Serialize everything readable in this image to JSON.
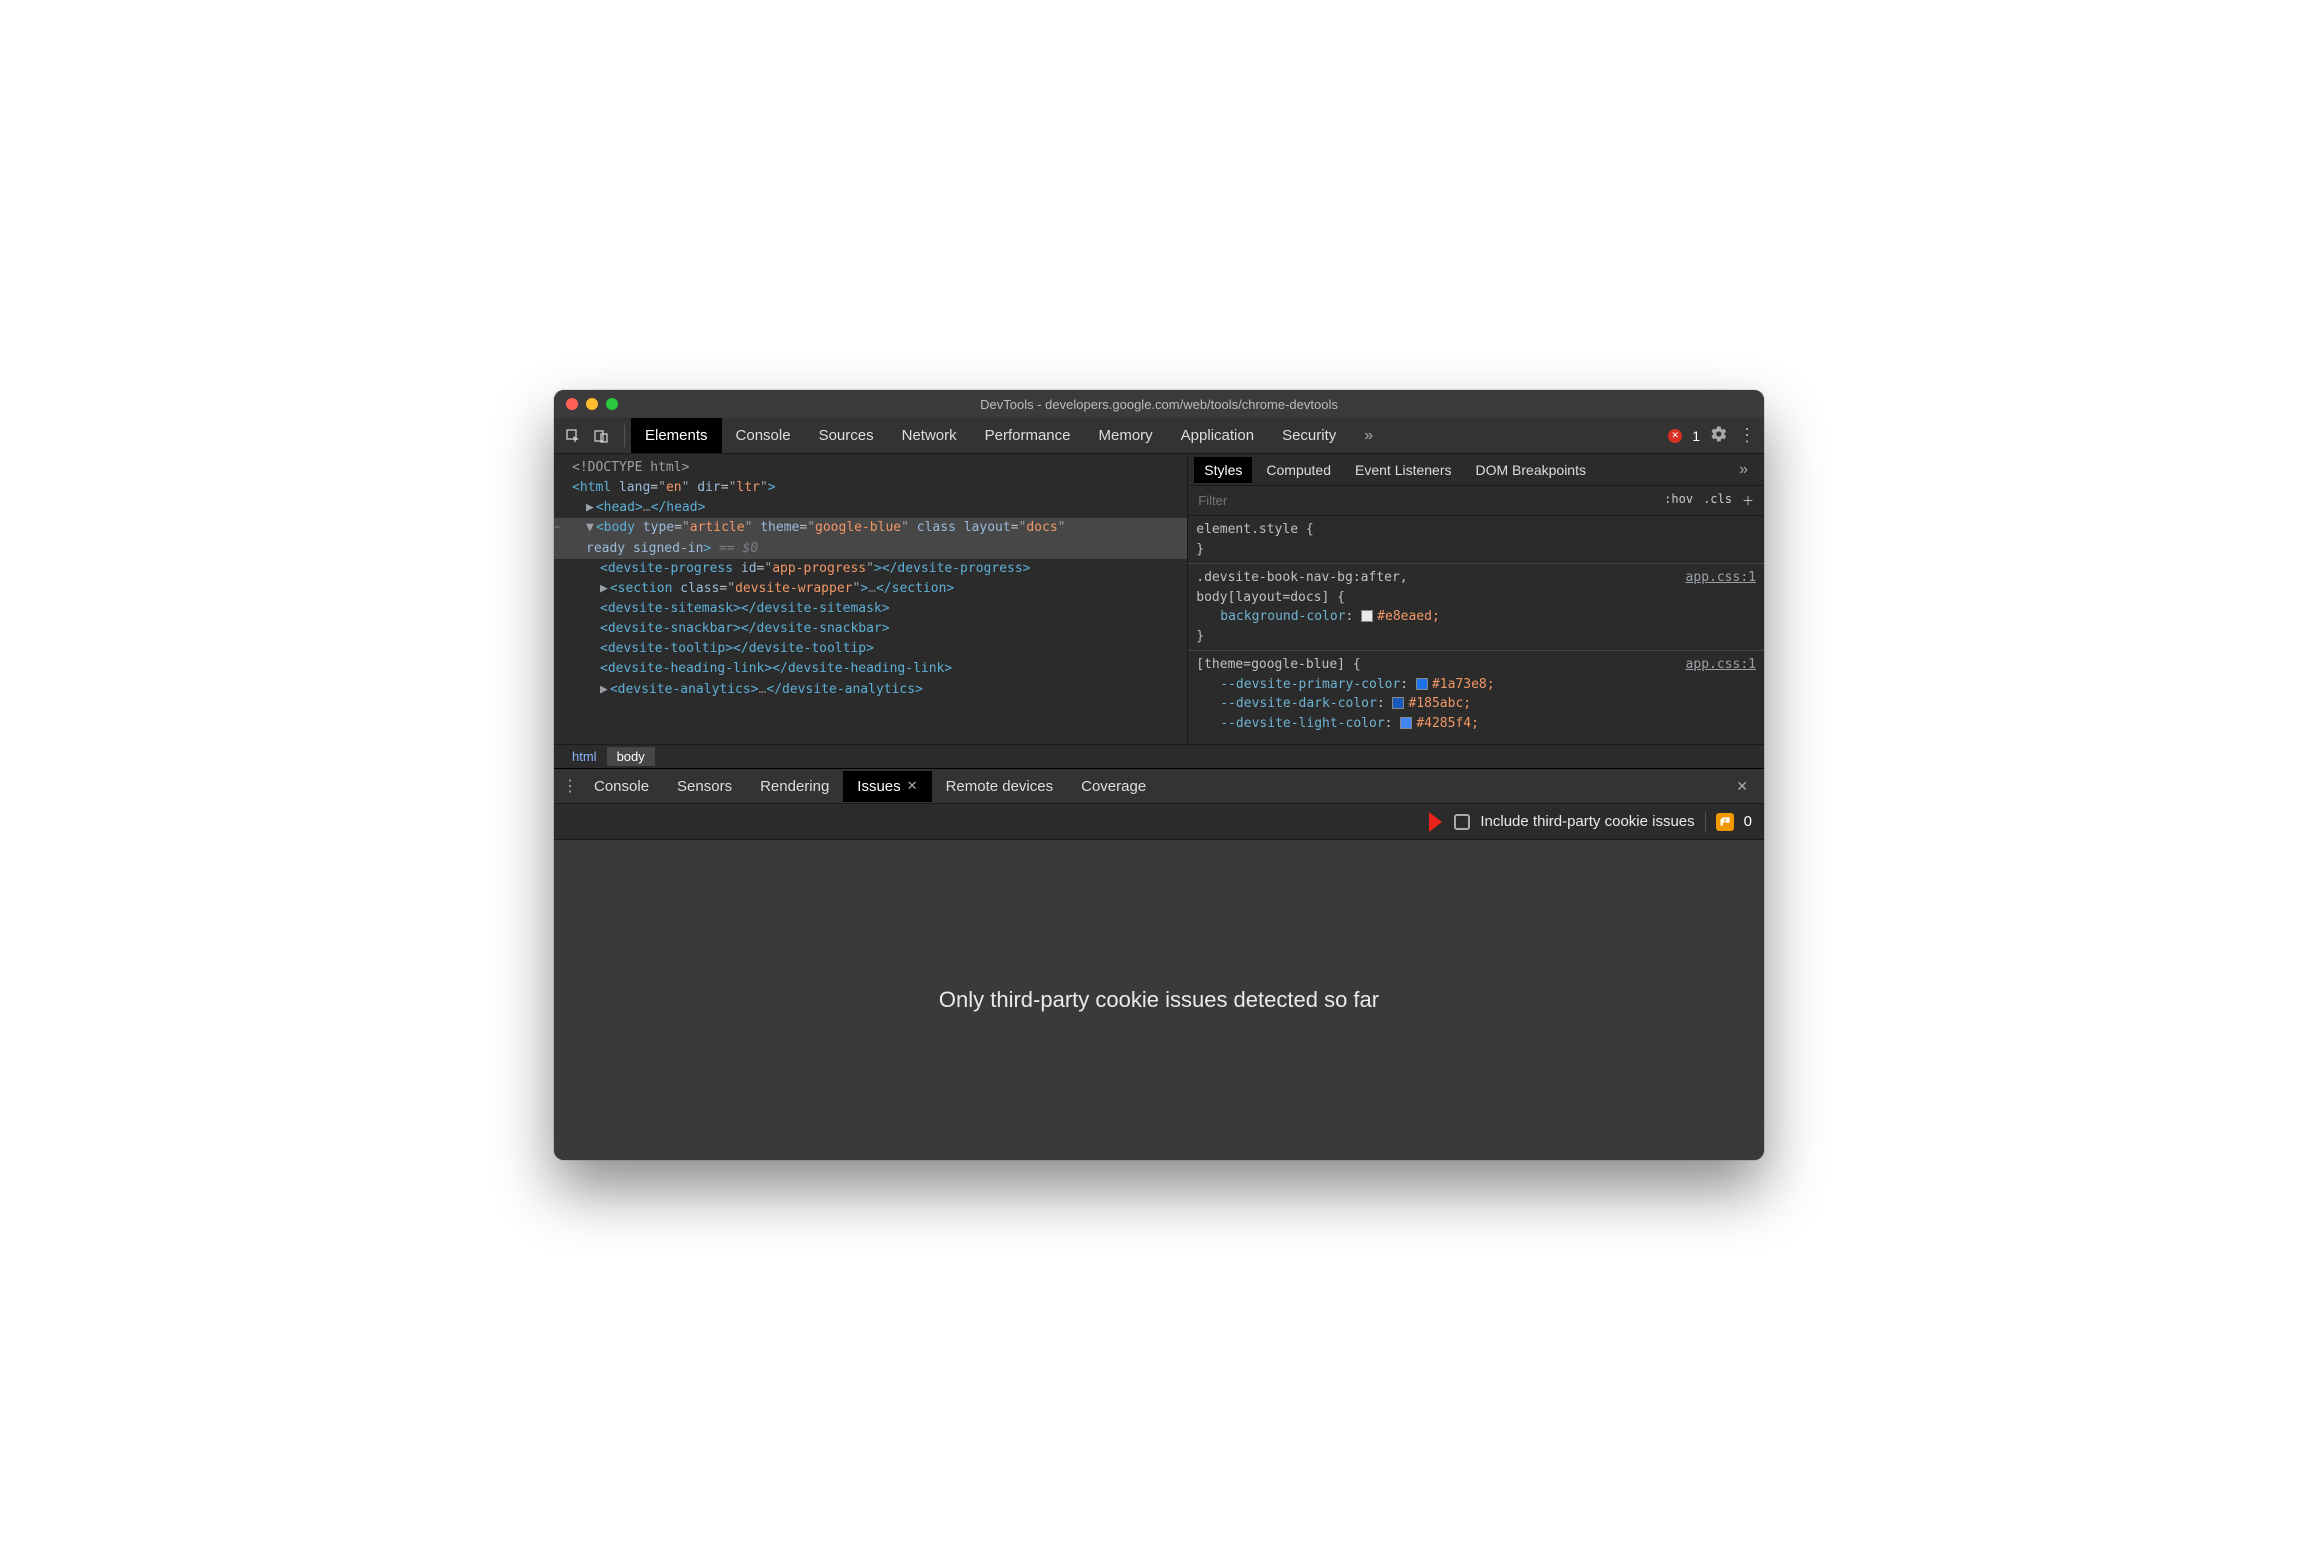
{
  "window": {
    "title": "DevTools - developers.google.com/web/tools/chrome-devtools"
  },
  "toolbar": {
    "tabs": [
      "Elements",
      "Console",
      "Sources",
      "Network",
      "Performance",
      "Memory",
      "Application",
      "Security"
    ],
    "active": "Elements",
    "more": "»",
    "error_count": "1"
  },
  "dom": {
    "doctype": "<!DOCTYPE html>",
    "html_open": {
      "tag": "html",
      "attrs": [
        [
          "lang",
          "en"
        ],
        [
          "dir",
          "ltr"
        ]
      ]
    },
    "head": {
      "open": "head",
      "ellipsis": "…",
      "close": "head"
    },
    "body_open": {
      "tag": "body",
      "attrs": [
        [
          "type",
          "article"
        ],
        [
          "theme",
          "google-blue"
        ]
      ],
      "bareattr": "class",
      "attrs2": [
        [
          "layout",
          "docs"
        ]
      ],
      "trail": "ready signed-in",
      "selected": " == $0"
    },
    "children": [
      {
        "tag": "devsite-progress",
        "attrs": [
          [
            "id",
            "app-progress"
          ]
        ],
        "close": "devsite-progress"
      },
      {
        "caret": true,
        "tag": "section",
        "attrs": [
          [
            "class",
            "devsite-wrapper"
          ]
        ],
        "ellipsis": "…",
        "close": "section"
      },
      {
        "tag": "devsite-sitemask",
        "close": "devsite-sitemask"
      },
      {
        "tag": "devsite-snackbar",
        "close": "devsite-snackbar"
      },
      {
        "tag": "devsite-tooltip",
        "close": "devsite-tooltip"
      },
      {
        "tag": "devsite-heading-link",
        "close": "devsite-heading-link"
      },
      {
        "caret": true,
        "tag": "devsite-analytics",
        "ellipsis": "…",
        "close": "devsite-analytics"
      }
    ]
  },
  "crumbs": {
    "items": [
      "html",
      "body"
    ],
    "active": "body"
  },
  "styles": {
    "subtabs": [
      "Styles",
      "Computed",
      "Event Listeners",
      "DOM Breakpoints"
    ],
    "active": "Styles",
    "more": "»",
    "filter_placeholder": "Filter",
    "hov": ":hov",
    "cls": ".cls",
    "plus": "＋",
    "rules": [
      {
        "selector": "element.style {",
        "props": [],
        "close": "}"
      },
      {
        "selector": ".devsite-book-nav-bg:after,",
        "selector2": "body[layout=docs] {",
        "link": "app.css:1",
        "props": [
          {
            "name": "background-color",
            "swatch": "#e8eaed",
            "value": "#e8eaed;"
          }
        ],
        "close": "}"
      },
      {
        "selector": "[theme=google-blue] {",
        "link": "app.css:1",
        "props": [
          {
            "name": "--devsite-primary-color",
            "swatch": "#1a73e8",
            "value": "#1a73e8;"
          },
          {
            "name": "--devsite-dark-color",
            "swatch": "#185abc",
            "value": "#185abc;"
          },
          {
            "name": "--devsite-light-color",
            "swatch": "#4285f4",
            "value": "#4285f4;"
          }
        ]
      }
    ]
  },
  "drawer": {
    "tabs": [
      "Console",
      "Sensors",
      "Rendering",
      "Issues",
      "Remote devices",
      "Coverage"
    ],
    "active": "Issues"
  },
  "issues": {
    "checkbox_label": "Include third-party cookie issues",
    "badge_count": "0",
    "empty_message": "Only third-party cookie issues detected so far"
  }
}
